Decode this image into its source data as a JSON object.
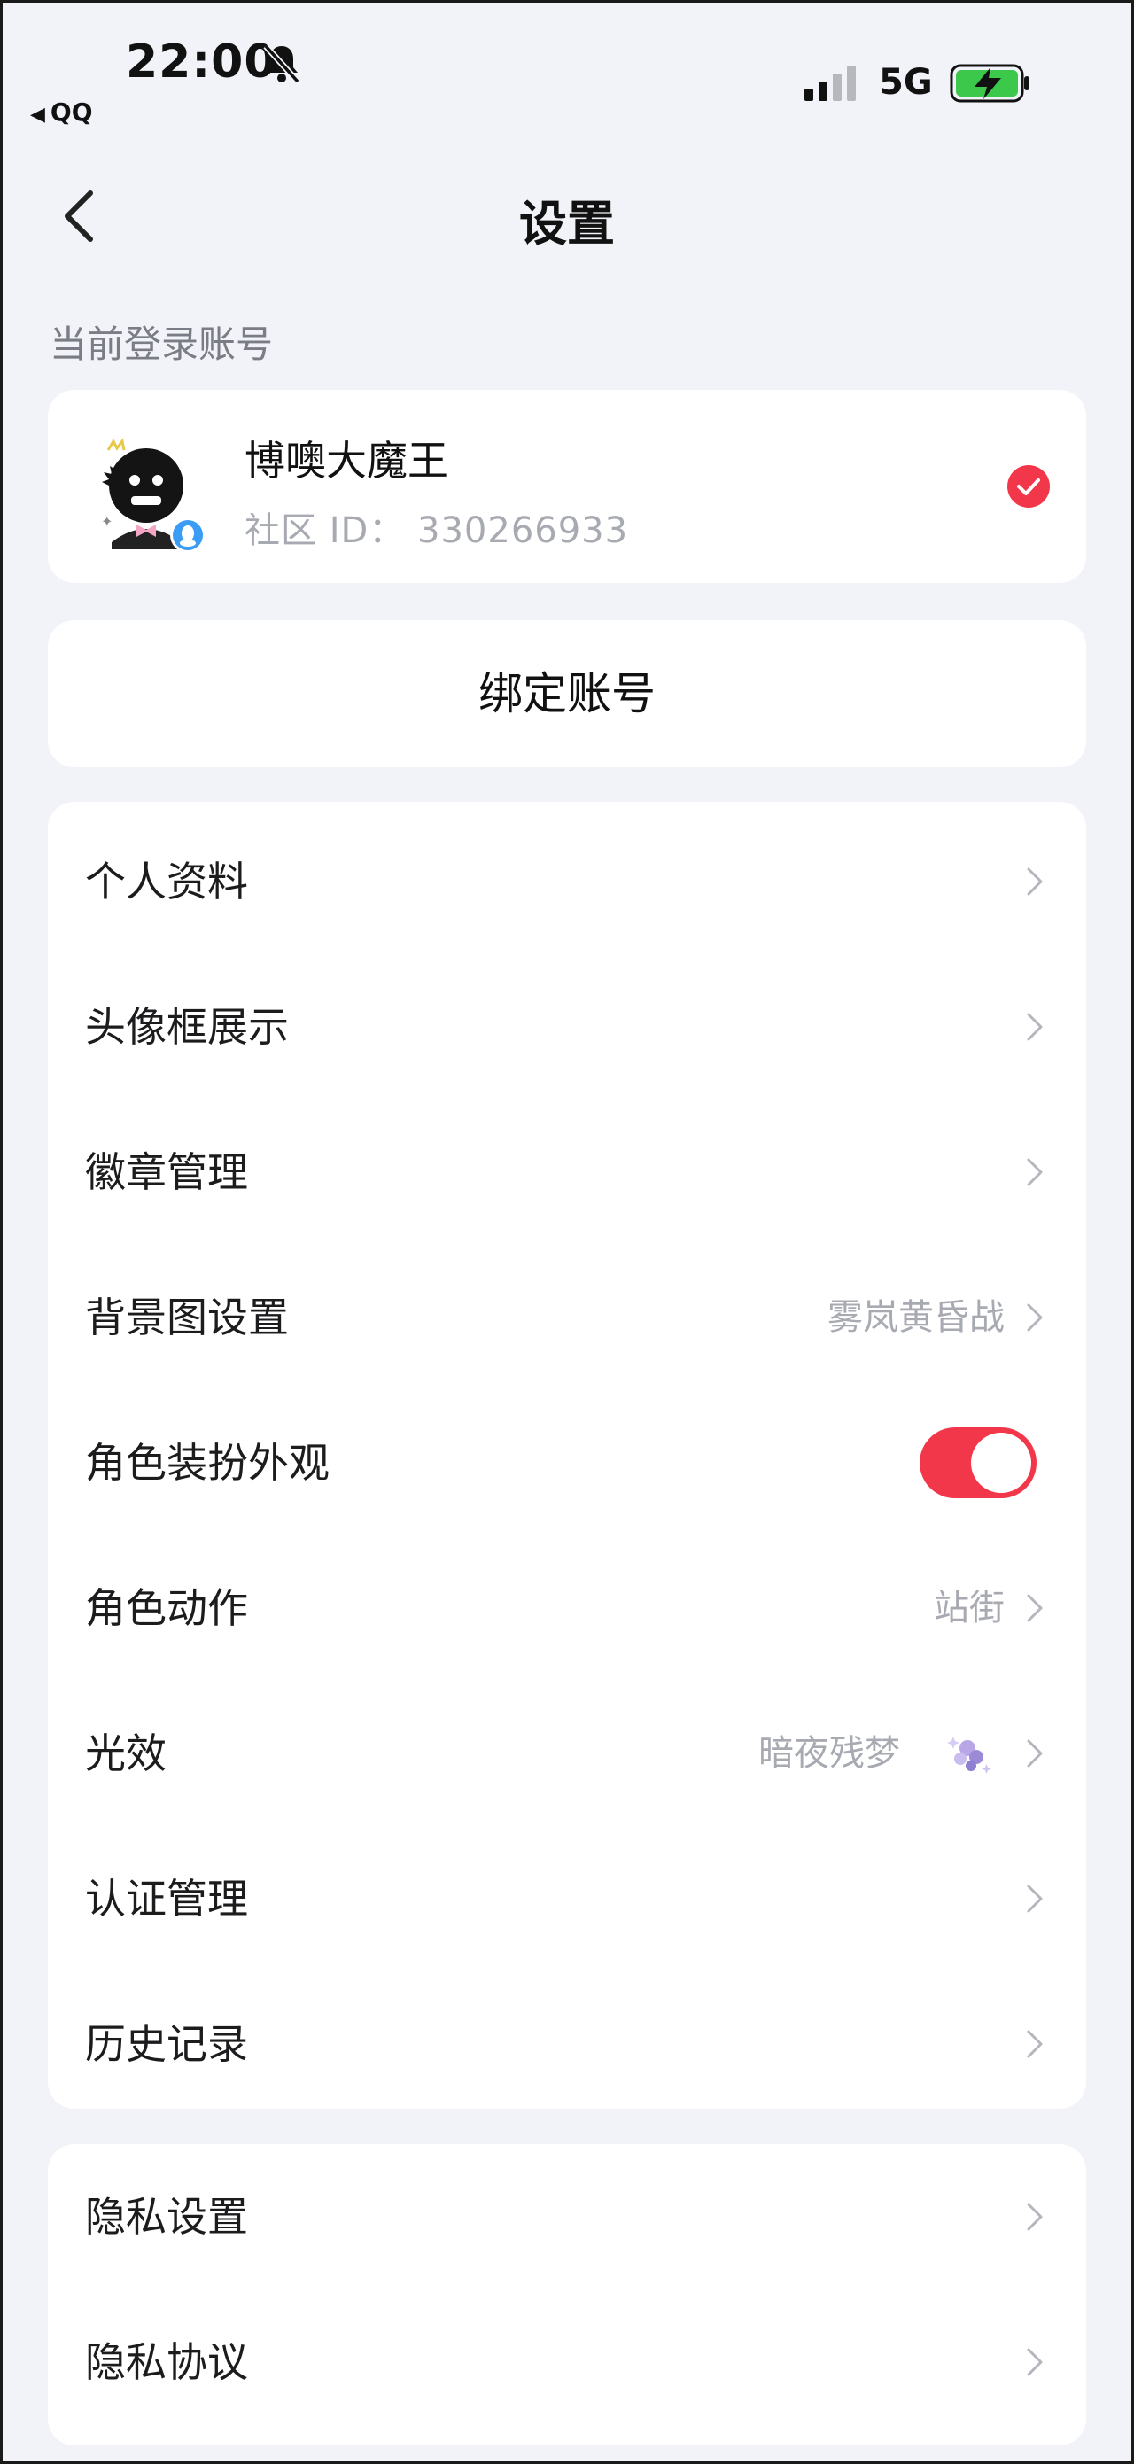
{
  "status_bar": {
    "time": "22:00",
    "back_app": "QQ",
    "network": "5G"
  },
  "nav": {
    "title": "设置"
  },
  "account_section": {
    "label": "当前登录账号",
    "name": "博噢大魔王",
    "community_id": "社区 ID：  330266933"
  },
  "bind": {
    "label": "绑定账号"
  },
  "menu_group_one": [
    {
      "label": "个人资料",
      "value": ""
    },
    {
      "label": "头像框展示",
      "value": ""
    },
    {
      "label": "徽章管理",
      "value": ""
    },
    {
      "label": "背景图设置",
      "value": "雾岚黄昏战"
    },
    {
      "label": "角色装扮外观",
      "value": "",
      "toggle_on": true
    },
    {
      "label": "角色动作",
      "value": "站街"
    },
    {
      "label": "光效",
      "value": "暗夜残梦"
    },
    {
      "label": "认证管理",
      "value": ""
    },
    {
      "label": "历史记录",
      "value": ""
    }
  ],
  "menu_group_two": [
    {
      "label": "隐私设置",
      "value": ""
    },
    {
      "label": "隐私协议",
      "value": ""
    }
  ],
  "colors": {
    "background": "#f2f3f8",
    "accent_red": "#f2374a",
    "secondary_text": "#a8aab2",
    "battery_green": "#3cc84a"
  },
  "icons": {
    "bell": "bell-muted-icon",
    "signal": "signal-bars-icon",
    "battery": "battery-charging-icon",
    "back": "chevron-left-icon",
    "check": "check-circle-icon",
    "chevron": "chevron-right-icon",
    "qq": "qq-penguin-icon",
    "light_effect": "light-effect-thumb-icon"
  }
}
